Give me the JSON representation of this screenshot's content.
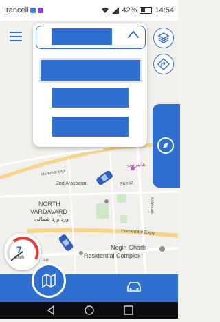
{
  "status_bar": {
    "carrier": "Irancell",
    "battery_percent": "42%",
    "time": "14:54",
    "icons": [
      "notification-icon",
      "wifi-icon",
      "signal-icon",
      "battery-icon"
    ]
  },
  "map": {
    "labels": {
      "persian_top": "هایپرمی",
      "street_east": "Hemmat Exp",
      "street_2nd": "2nd Arasbaran",
      "street_shiraz": "Shiraz",
      "area_en_1": "NORTH",
      "area_en_2": "VARDAVARD",
      "area_fa": "وردآورد شمالی",
      "street_ardestani": "Ardestani",
      "street_hamedani": "Hamedani Expy",
      "poi_1": "Negin Gharb",
      "poi_2": "Residential Complex",
      "street_bottom": "Isth"
    }
  },
  "speedometer": {
    "speed": "7",
    "unit": "km/h"
  },
  "colors": {
    "primary": "#2f6fd0",
    "white": "#ffffff"
  },
  "icons": {
    "menu": "hamburger-icon",
    "layers": "layers-icon",
    "route": "route-diamond-icon",
    "compass": "compass-icon",
    "map_tab": "map-icon",
    "car_tab": "car-icon"
  }
}
